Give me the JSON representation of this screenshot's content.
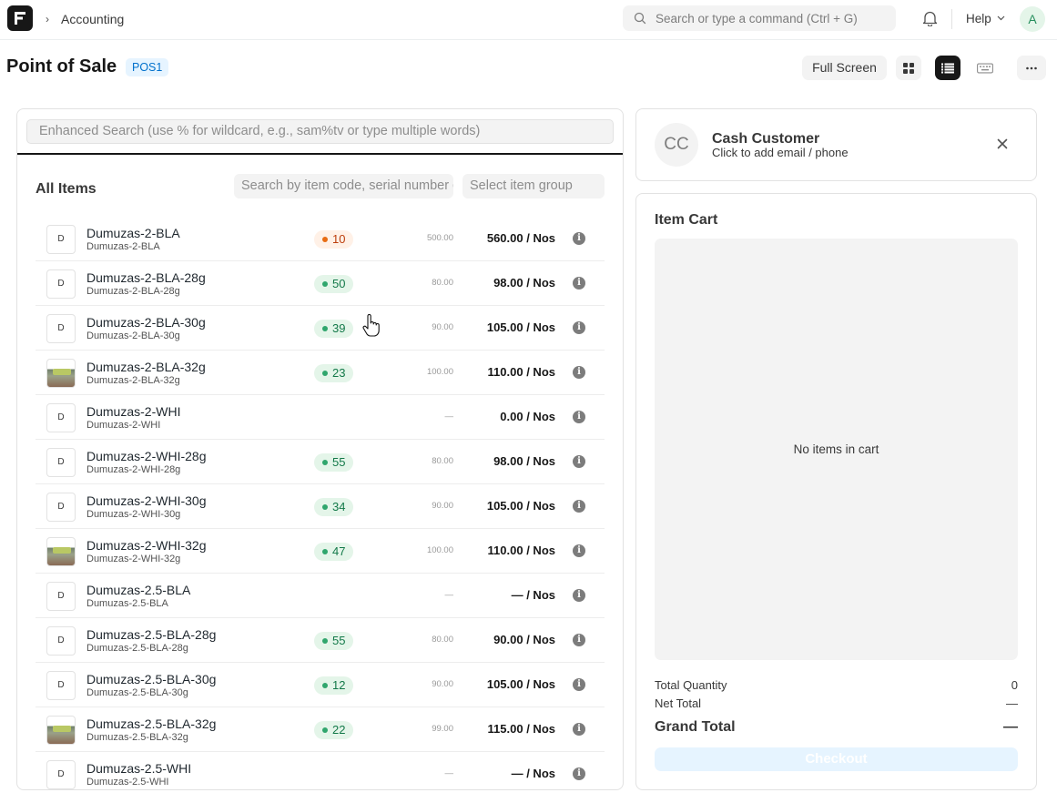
{
  "navbar": {
    "breadcrumb": "Accounting",
    "search_placeholder": "Search or type a command (Ctrl + G)",
    "help_label": "Help",
    "avatar_initial": "A"
  },
  "page": {
    "title": "Point of Sale",
    "badge": "POS1",
    "full_screen_label": "Full Screen"
  },
  "items_panel": {
    "enhanced_search_placeholder": "Enhanced Search (use % for wildcard, e.g., sam%tv or type multiple words)",
    "heading": "All Items",
    "code_search_placeholder": "Search by item code, serial number or barcode",
    "group_placeholder": "Select item group",
    "items": [
      {
        "thumb": "D",
        "name": "Dumuzas-2-BLA",
        "code": "Dumuzas-2-BLA",
        "qty": "10",
        "stock": "low",
        "old_price": "500.00",
        "price": "560.00 / Nos"
      },
      {
        "thumb": "D",
        "name": "Dumuzas-2-BLA-28g",
        "code": "Dumuzas-2-BLA-28g",
        "qty": "50",
        "stock": "ok",
        "old_price": "80.00",
        "price": "98.00 / Nos"
      },
      {
        "thumb": "D",
        "name": "Dumuzas-2-BLA-30g",
        "code": "Dumuzas-2-BLA-30g",
        "qty": "39",
        "stock": "ok",
        "old_price": "90.00",
        "price": "105.00 / Nos"
      },
      {
        "thumb": "",
        "image": true,
        "name": "Dumuzas-2-BLA-32g",
        "code": "Dumuzas-2-BLA-32g",
        "qty": "23",
        "stock": "ok",
        "old_price": "100.00",
        "price": "110.00 / Nos"
      },
      {
        "thumb": "D",
        "name": "Dumuzas-2-WHI",
        "code": "Dumuzas-2-WHI",
        "qty": "",
        "stock": "none",
        "old_price": "—",
        "price": "0.00 / Nos"
      },
      {
        "thumb": "D",
        "name": "Dumuzas-2-WHI-28g",
        "code": "Dumuzas-2-WHI-28g",
        "qty": "55",
        "stock": "ok",
        "old_price": "80.00",
        "price": "98.00 / Nos"
      },
      {
        "thumb": "D",
        "name": "Dumuzas-2-WHI-30g",
        "code": "Dumuzas-2-WHI-30g",
        "qty": "34",
        "stock": "ok",
        "old_price": "90.00",
        "price": "105.00 / Nos"
      },
      {
        "thumb": "",
        "image": true,
        "name": "Dumuzas-2-WHI-32g",
        "code": "Dumuzas-2-WHI-32g",
        "qty": "47",
        "stock": "ok",
        "old_price": "100.00",
        "price": "110.00 / Nos"
      },
      {
        "thumb": "D",
        "name": "Dumuzas-2.5-BLA",
        "code": "Dumuzas-2.5-BLA",
        "qty": "",
        "stock": "none",
        "old_price": "—",
        "price": "— / Nos"
      },
      {
        "thumb": "D",
        "name": "Dumuzas-2.5-BLA-28g",
        "code": "Dumuzas-2.5-BLA-28g",
        "qty": "55",
        "stock": "ok",
        "old_price": "80.00",
        "price": "90.00 / Nos"
      },
      {
        "thumb": "D",
        "name": "Dumuzas-2.5-BLA-30g",
        "code": "Dumuzas-2.5-BLA-30g",
        "qty": "12",
        "stock": "ok",
        "old_price": "90.00",
        "price": "105.00 / Nos"
      },
      {
        "thumb": "",
        "image": true,
        "name": "Dumuzas-2.5-BLA-32g",
        "code": "Dumuzas-2.5-BLA-32g",
        "qty": "22",
        "stock": "ok",
        "old_price": "99.00",
        "price": "115.00 / Nos"
      },
      {
        "thumb": "D",
        "name": "Dumuzas-2.5-WHI",
        "code": "Dumuzas-2.5-WHI",
        "qty": "",
        "stock": "none",
        "old_price": "—",
        "price": "— / Nos"
      }
    ]
  },
  "customer": {
    "initials": "CC",
    "name": "Cash Customer",
    "subtitle": "Click to add email / phone"
  },
  "cart": {
    "title": "Item Cart",
    "empty_text": "No items in cart",
    "total_quantity_label": "Total Quantity",
    "total_quantity_value": "0",
    "net_total_label": "Net Total",
    "net_total_value": "—",
    "grand_total_label": "Grand Total",
    "grand_total_value": "—",
    "checkout_label": "Checkout"
  },
  "colors": {
    "accent_dark": "#171717",
    "stock_ok": "#30a66d",
    "stock_low": "#e86c13",
    "checkout_bg": "#e6f4ff"
  }
}
